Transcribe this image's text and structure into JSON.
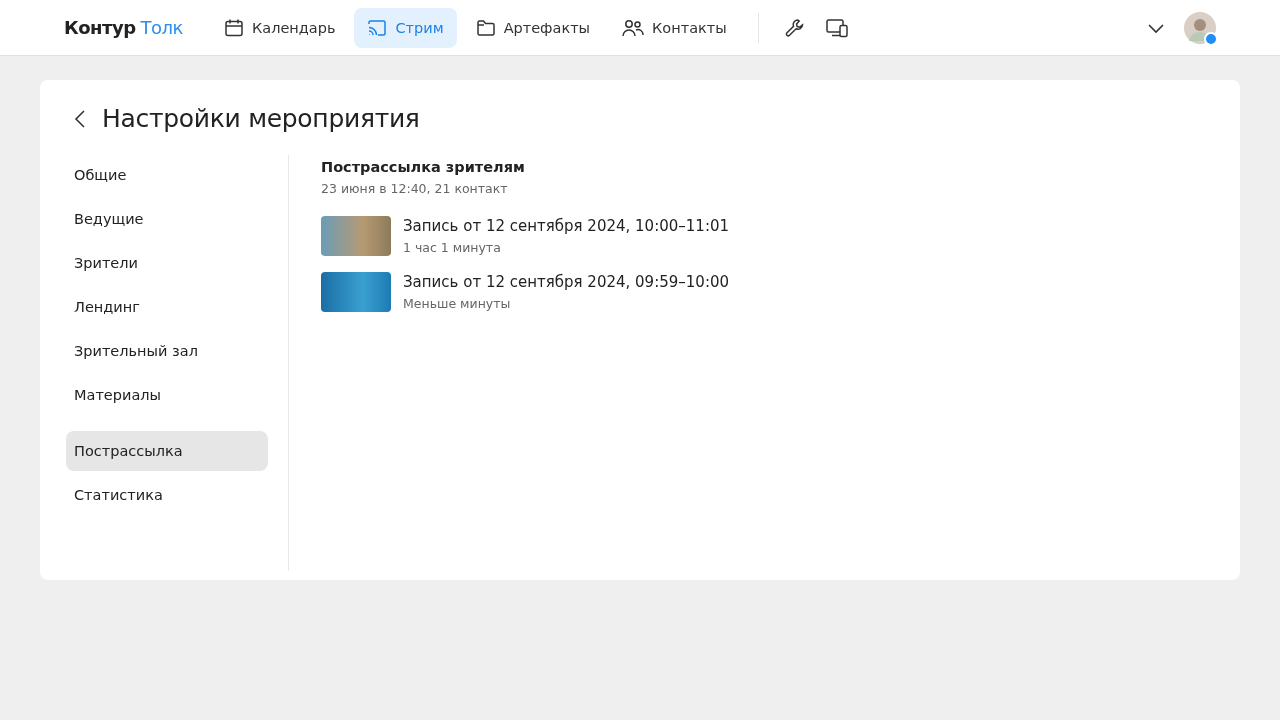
{
  "header": {
    "logo": {
      "brand": "Контур",
      "product": "Толк"
    },
    "nav": [
      {
        "kind": "calendar",
        "label": "Календарь",
        "selected": false
      },
      {
        "kind": "cast",
        "label": "Стрим",
        "selected": true
      },
      {
        "kind": "folder",
        "label": "Артефакты",
        "selected": false
      },
      {
        "kind": "people",
        "label": "Контакты",
        "selected": false
      }
    ],
    "tools": [
      {
        "kind": "wrench"
      },
      {
        "kind": "devices"
      }
    ]
  },
  "page": {
    "title": "Настройки мероприятия",
    "sidebar_groups": [
      [
        {
          "label": "Общие",
          "selected": false
        },
        {
          "label": "Ведущие",
          "selected": false
        },
        {
          "label": "Зрители",
          "selected": false
        },
        {
          "label": "Лендинг",
          "selected": false
        },
        {
          "label": "Зрительный зал",
          "selected": false
        },
        {
          "label": "Материалы",
          "selected": false
        }
      ],
      [
        {
          "label": "Пострассылка",
          "selected": true
        },
        {
          "label": "Статистика",
          "selected": false
        }
      ]
    ],
    "section": {
      "title": "Пострассылка зрителям",
      "subtitle": "23 июня в 12:40, 21 контакт",
      "recordings": [
        {
          "title": "Запись от 12 сентября 2024, 10:00–11:01",
          "duration": "1 час 1 минута"
        },
        {
          "title": "Запись от 12 сентября 2024, 09:59–10:00",
          "duration": "Меньше минуты"
        }
      ]
    }
  }
}
